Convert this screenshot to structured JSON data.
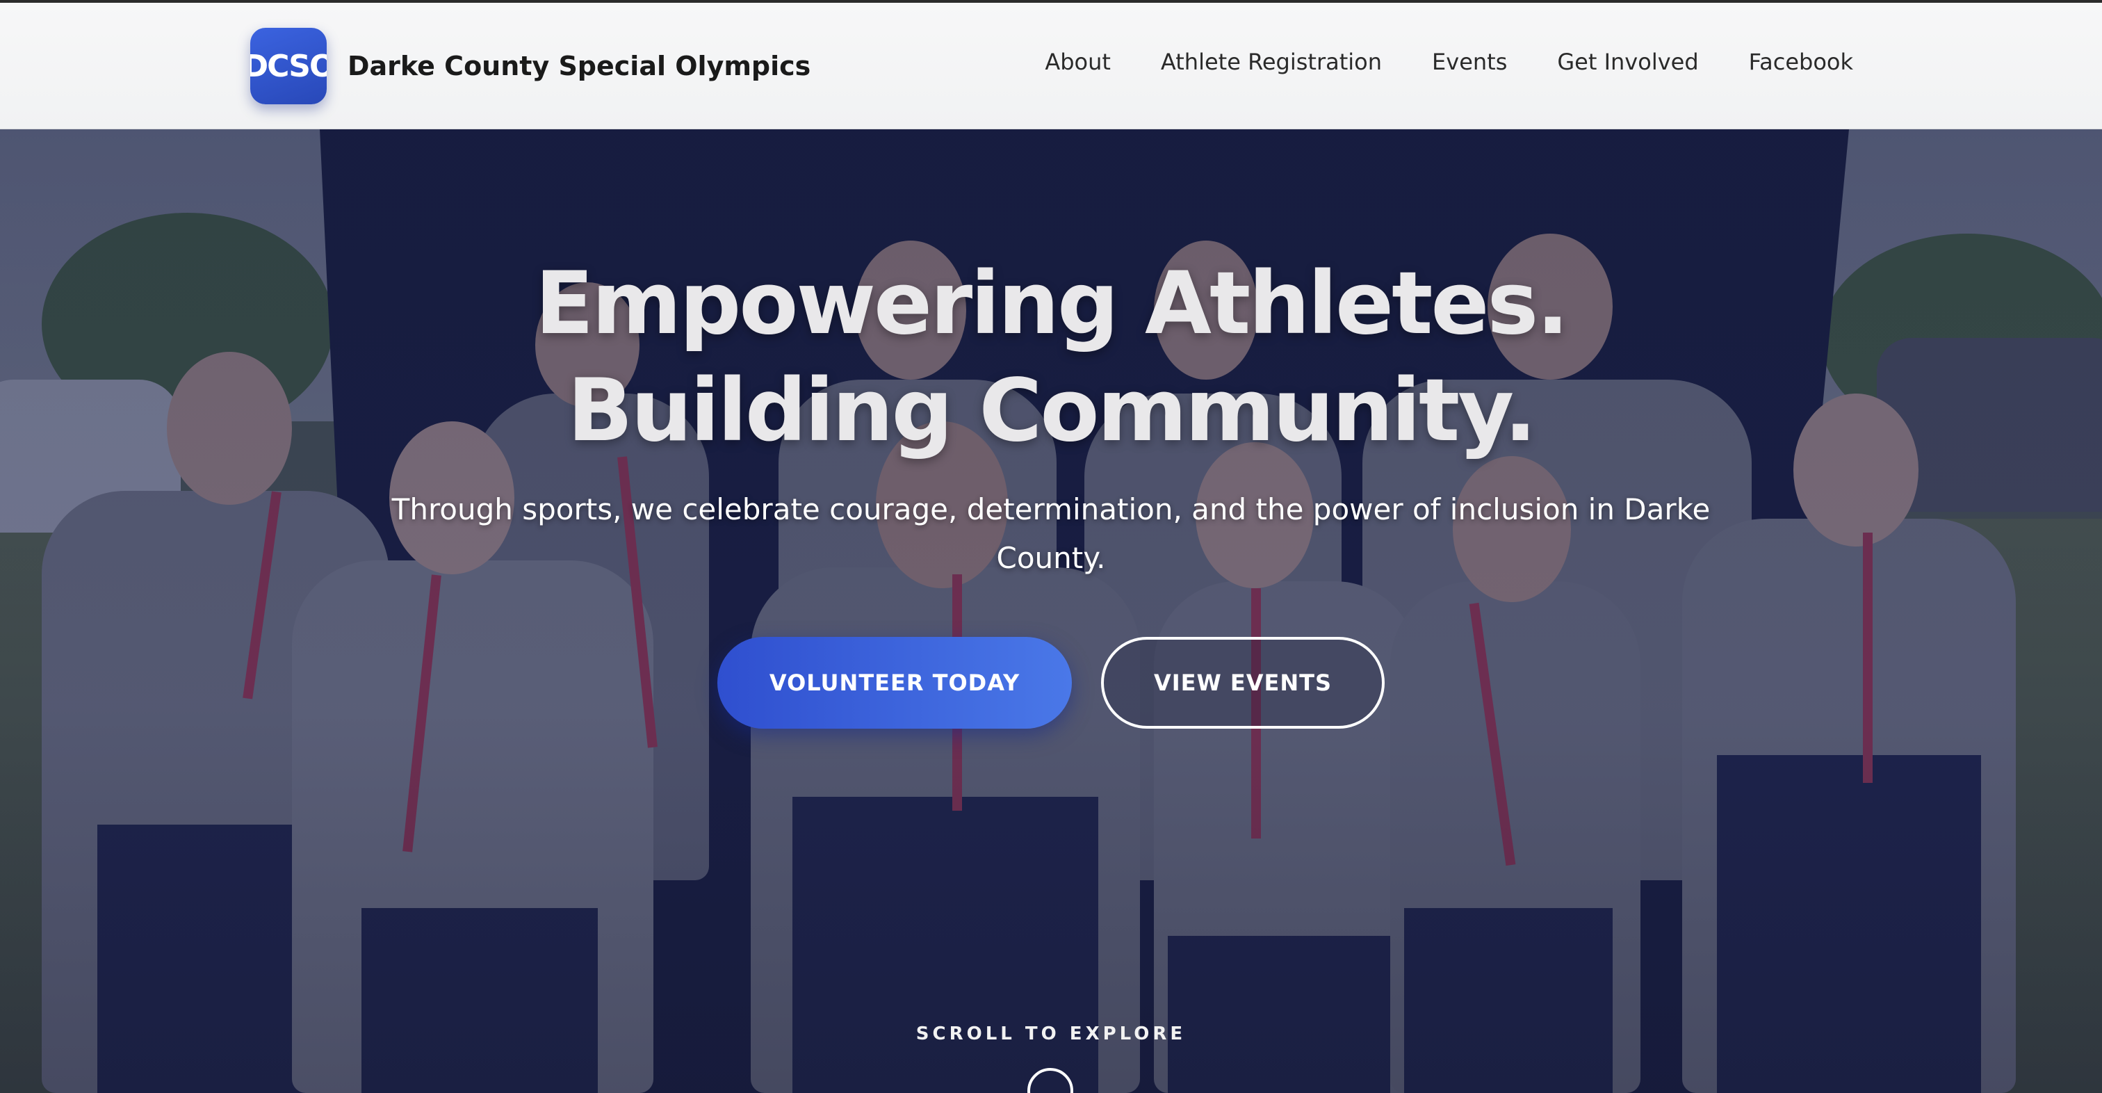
{
  "brand": {
    "logo_text": "DCSO",
    "name": "Darke County Special Olympics"
  },
  "nav": {
    "items": [
      {
        "label": "About"
      },
      {
        "label": "Athlete Registration"
      },
      {
        "label": "Events"
      },
      {
        "label": "Get Involved"
      },
      {
        "label": "Facebook"
      }
    ]
  },
  "hero": {
    "headline_line1": "Empowering Athletes.",
    "headline_line2": "Building Community.",
    "subheadline": "Through sports, we celebrate courage, determination, and the power of inclusion in Darke County.",
    "primary_button": "VOLUNTEER TODAY",
    "secondary_button": "VIEW EVENTS",
    "scroll_label": "SCROLL TO EXPLORE"
  },
  "colors": {
    "accent": "#3b63e0",
    "overlay": "#1c224a",
    "nav_background": "#f4f5f6"
  }
}
